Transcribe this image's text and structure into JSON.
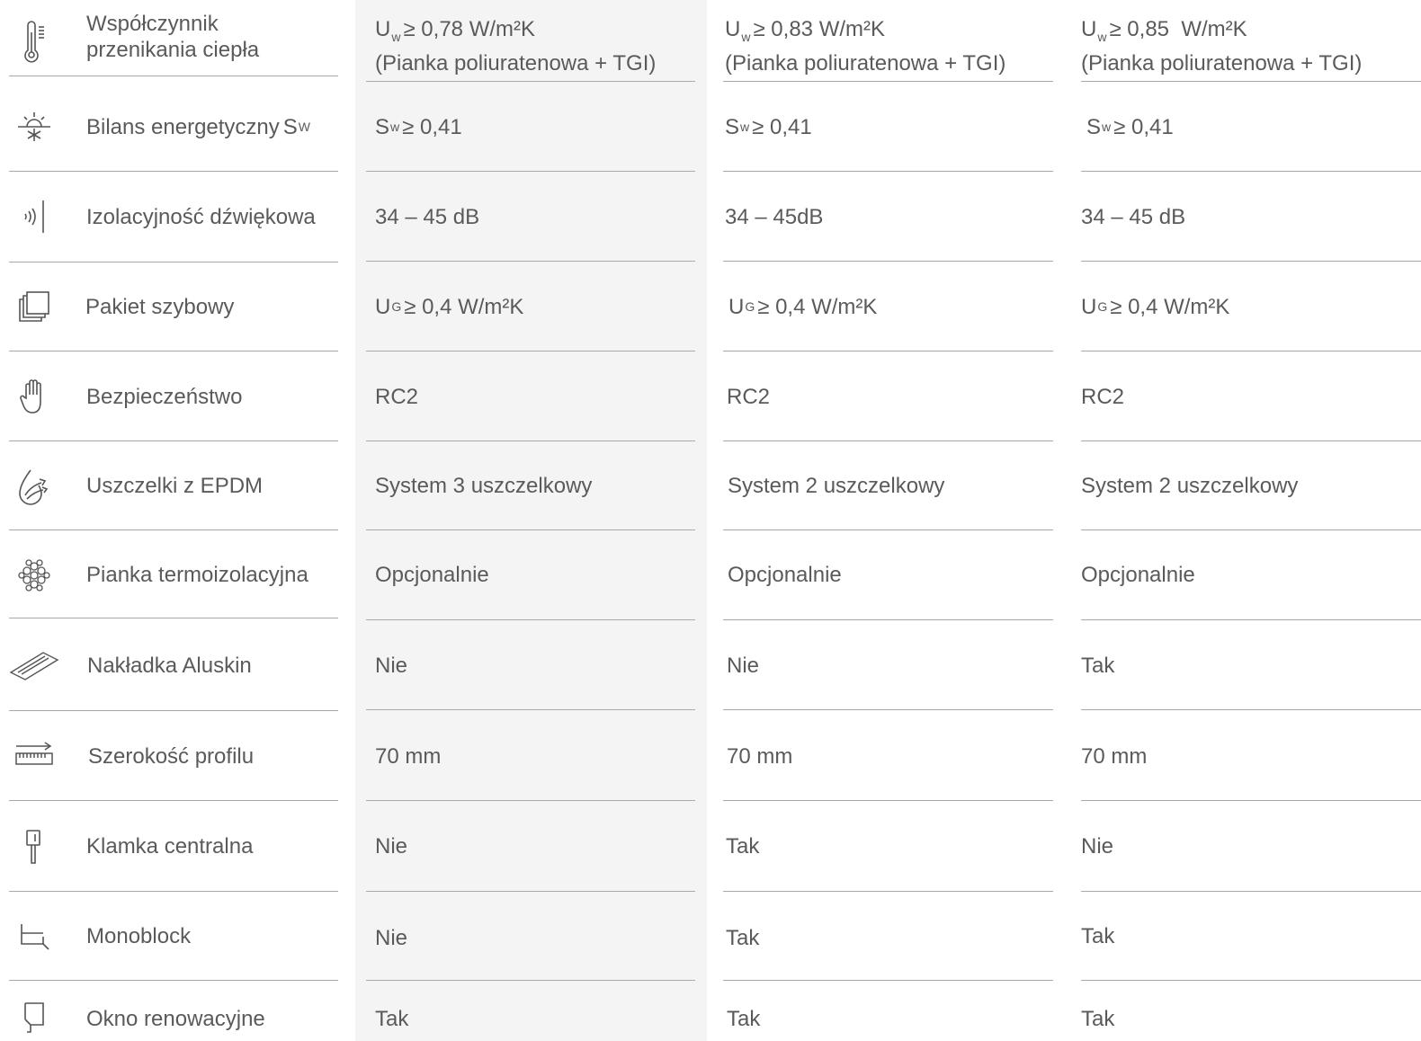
{
  "rows": [
    {
      "icon": "thermometer-icon",
      "label": "Współczynnik przenikania ciepła",
      "v1": {
        "sym": "U",
        "sub": "w",
        "rest": "≥ 0,78 W/m²K",
        "line2": "(Pianka poliuratenowa + TGI)"
      },
      "v2": {
        "sym": "U",
        "sub": "w",
        "rest": "≥ 0,83 W/m²K",
        "line2": "(Pianka poliuratenowa + TGI)"
      },
      "v3": {
        "sym": "U",
        "sub": "w",
        "rest": "≥ 0,85  W/m²K",
        "line2": "(Pianka poliuratenowa + TGI)"
      }
    },
    {
      "icon": "sun-snowflake-icon",
      "label": "Bilans energetyczny",
      "label_sym": "S",
      "label_sub": "W",
      "v1": {
        "sym": "S",
        "sub": "w",
        "rest": "≥ 0,41"
      },
      "v2": {
        "sym": "S",
        "sub": "w",
        "rest": "≥ 0,41"
      },
      "v3": {
        "sym": "S",
        "sub": "w",
        "rest": "≥ 0,41"
      }
    },
    {
      "icon": "sound-waves-icon",
      "label": "Izolacyjność dźwiękowa",
      "v1": "34 – 45 dB",
      "v2": "34 – 45dB",
      "v3": "34 – 45 dB"
    },
    {
      "icon": "glass-panes-icon",
      "label": "Pakiet szybowy",
      "v1": {
        "sym": "U",
        "sub": "G",
        "rest": "≥ 0,4 W/m²K"
      },
      "v2": {
        "sym": "U",
        "sub": "G",
        "rest": "≥ 0,4 W/m²K"
      },
      "v3": {
        "sym": "U",
        "sub": "G",
        "rest": "≥ 0,4 W/m²K"
      }
    },
    {
      "icon": "hand-icon",
      "label": "Bezpieczeństwo",
      "v1": "RC2",
      "v2": "RC2",
      "v3": "RC2"
    },
    {
      "icon": "water-drop-icon",
      "label": "Uszczelki z EPDM",
      "v1": "System 3 uszczelkowy",
      "v2": "System 2 uszczelkowy",
      "v3": "System 2 uszczelkowy"
    },
    {
      "icon": "foam-bubbles-icon",
      "label": "Pianka termoizolacyjna",
      "v1": "Opcjonalnie",
      "v2": "Opcjonalnie",
      "v3": "Opcjonalnie"
    },
    {
      "icon": "aluskin-profile-icon",
      "label": "Nakładka Aluskin",
      "v1": "Nie",
      "v2": "Nie",
      "v3": "Tak"
    },
    {
      "icon": "ruler-width-icon",
      "label": "Szerokość profilu",
      "v1": "70 mm",
      "v2": "70 mm",
      "v3": "70 mm"
    },
    {
      "icon": "window-handle-icon",
      "label": "Klamka centralna",
      "v1": "Nie",
      "v2": "Tak",
      "v3": "Nie"
    },
    {
      "icon": "monoblock-icon",
      "label": "Monoblock",
      "v1": "Nie",
      "v2": "Tak",
      "v3": "Tak"
    },
    {
      "icon": "renovation-window-icon",
      "label": "Okno renowacyjne",
      "v1": "Tak",
      "v2": "Tak",
      "v3": "Tak"
    }
  ]
}
